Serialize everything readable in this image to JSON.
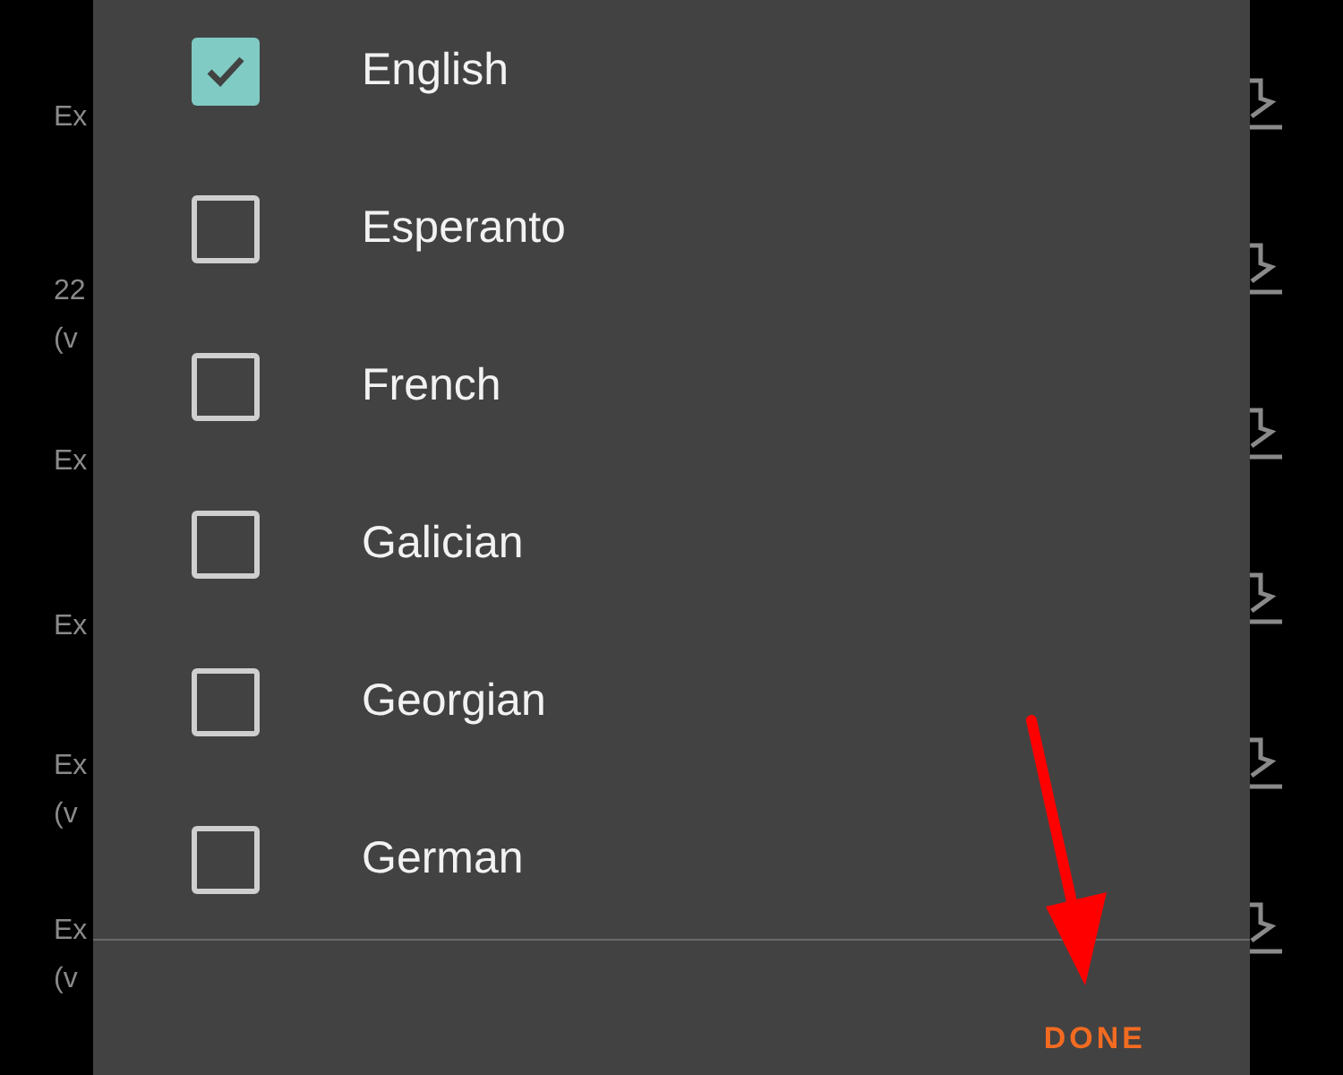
{
  "background_rows": [
    {
      "lines": [
        "Ex"
      ]
    },
    {
      "lines": [
        "22",
        "(v"
      ]
    },
    {
      "lines": [
        "Ex"
      ]
    },
    {
      "lines": [
        "Ex"
      ]
    },
    {
      "lines": [
        "Ex",
        "(v"
      ]
    },
    {
      "lines": [
        "Ex",
        "(v"
      ]
    }
  ],
  "dialog": {
    "languages": [
      {
        "label": "English",
        "checked": true
      },
      {
        "label": "Esperanto",
        "checked": false
      },
      {
        "label": "French",
        "checked": false
      },
      {
        "label": "Galician",
        "checked": false
      },
      {
        "label": "Georgian",
        "checked": false
      },
      {
        "label": "German",
        "checked": false
      }
    ],
    "done_button": "DONE"
  }
}
